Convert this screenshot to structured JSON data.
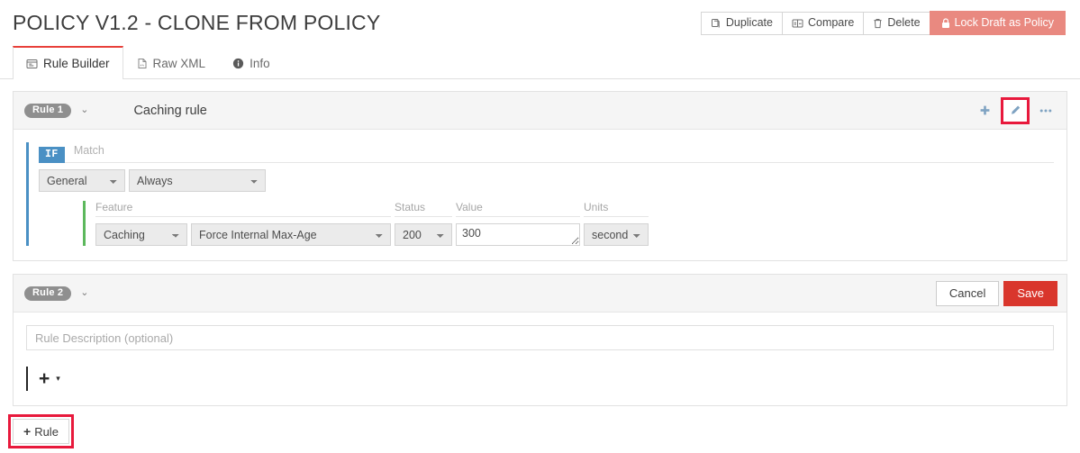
{
  "header": {
    "title": "POLICY V1.2 - CLONE FROM POLICY",
    "actions": [
      {
        "label": "Duplicate",
        "icon": "duplicate-icon"
      },
      {
        "label": "Compare",
        "icon": "compare-icon"
      },
      {
        "label": "Delete",
        "icon": "trash-icon"
      }
    ],
    "lock_button": {
      "label": "Lock Draft as Policy",
      "icon": "lock-icon",
      "color": "#e98980"
    }
  },
  "tabs": [
    {
      "label": "Rule Builder",
      "icon": "rule-builder-icon",
      "active": true
    },
    {
      "label": "Raw XML",
      "icon": "xml-file-icon",
      "active": false
    },
    {
      "label": "Info",
      "icon": "info-icon",
      "active": false
    }
  ],
  "colors": {
    "accent_red": "#e8403a",
    "save_red": "#d9362c",
    "highlight_red": "#e8193c",
    "match_bar_blue": "#4a90c4",
    "action_bar_green": "#5cb85c",
    "icon_blue": "#7fa3c2",
    "badge_gray": "#8f8f8f"
  },
  "rule1": {
    "badge": "Rule 1",
    "caret": "⌄",
    "name": "Caching rule",
    "actions": {
      "add": "add-icon",
      "edit": "edit-pencil-icon",
      "more": "more-options-icon"
    },
    "match": {
      "if_label": "IF",
      "match_label": "Match",
      "scope_value": "General",
      "condition_value": "Always"
    },
    "action": {
      "labels": {
        "feature": "Feature",
        "status": "Status",
        "value": "Value",
        "units": "Units"
      },
      "feature_value": "Caching",
      "action_value": "Force Internal Max-Age",
      "status_value": "200",
      "value_value": "300",
      "units_value": "seconds"
    }
  },
  "rule2": {
    "badge": "Rule 2",
    "caret": "⌄",
    "cancel_label": "Cancel",
    "save_label": "Save",
    "description_placeholder": "Rule Description (optional)",
    "description_value": "",
    "add_plus": "+",
    "add_caret": "▾"
  },
  "add_rule_button": {
    "label": "Rule",
    "plus": "+",
    "icon": "plus-icon"
  }
}
